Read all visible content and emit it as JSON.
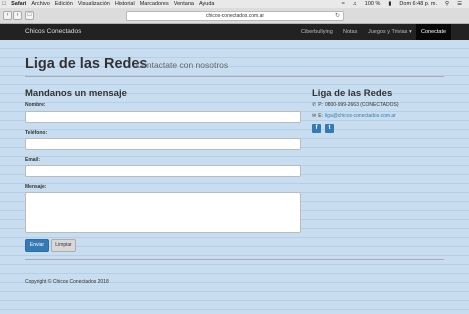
{
  "menubar": {
    "items": [
      "Safari",
      "Archivo",
      "Edición",
      "Visualización",
      "Historial",
      "Marcadores",
      "Ventana",
      "Ayuda"
    ],
    "battery": "100 %",
    "clock": "Dom 6:48 p. m."
  },
  "browser": {
    "url": "chicos-conectados.com.ar"
  },
  "navbar": {
    "brand": "Chicos Conectados",
    "items": [
      "Ciberbullying",
      "Notas",
      "Juegos y Trivias",
      "Conectate"
    ]
  },
  "page": {
    "title": "Liga de las Redes",
    "subtitle": "Contactate con nosotros"
  },
  "form": {
    "heading": "Mandanos un mensaje",
    "name_label": "Nombre:",
    "name_value": "",
    "phone_label": "Teléfono:",
    "phone_value": "",
    "email_label": "Email:",
    "email_value": "",
    "message_label": "Mensaje:",
    "message_value": "",
    "send_label": "Enviar",
    "clear_label": "Limpiar"
  },
  "sidebar": {
    "heading": "Liga de las Redes",
    "phone_prefix": "P:",
    "phone": "0800-999-2663 (CONECTADOS)",
    "email_prefix": "E:",
    "email": "liga@chicos-conectados.com.ar"
  },
  "footer": {
    "copyright": "Copyright © Chicos Conectados 2018"
  },
  "colors": {
    "navbar": "#222222",
    "primary": "#337ab7",
    "background": "#c9dff0"
  }
}
